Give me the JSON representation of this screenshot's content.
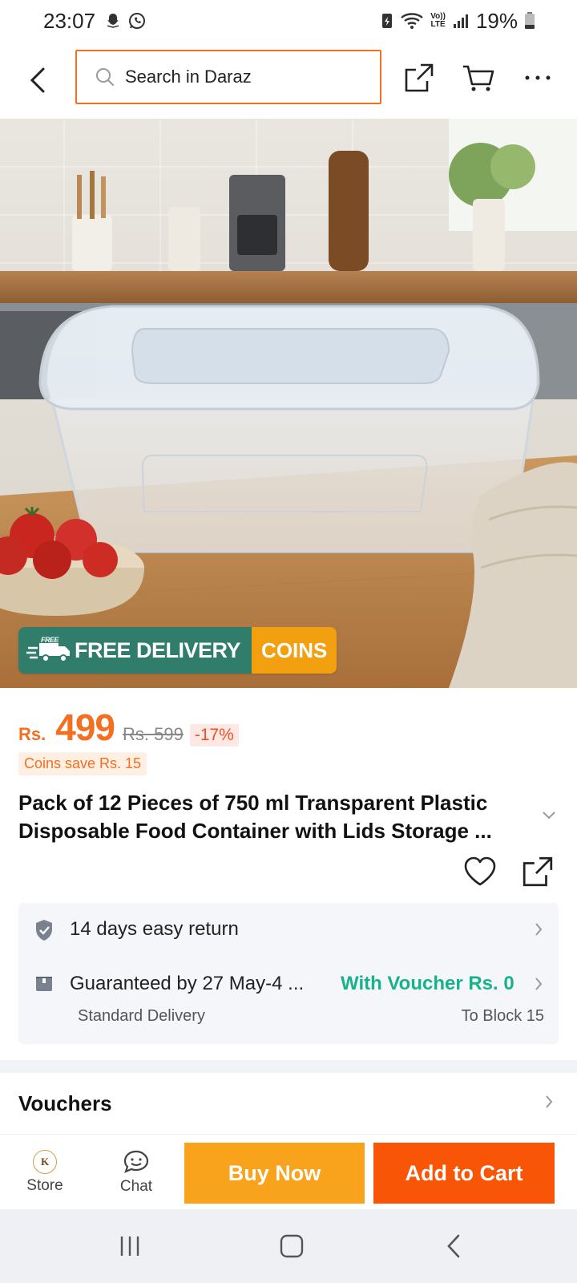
{
  "status_bar": {
    "time": "23:07",
    "battery": "19%",
    "icons": [
      "snapchat-icon",
      "whatsapp-icon",
      "battery-saver-icon",
      "wifi-icon",
      "volte-icon",
      "signal-icon",
      "battery-icon"
    ],
    "lte_label_top": "Vo))",
    "lte_label_bottom": "LTE"
  },
  "header": {
    "search_placeholder": "Search in Daraz",
    "icons": [
      "back-icon",
      "search-icon",
      "share-icon",
      "cart-icon",
      "more-icon"
    ]
  },
  "promo": {
    "free_tag": "FREE",
    "free_delivery": "FREE DELIVERY",
    "coins": "COINS"
  },
  "price": {
    "currency": "Rs.",
    "amount": "499",
    "original": "Rs. 599",
    "discount": "-17%",
    "coins_save": "Coins save Rs. 15"
  },
  "product": {
    "title": "Pack of 12 Pieces of 750 ml Transparent Plastic Disposable Food Container with Lids Storage ..."
  },
  "services": {
    "return_text": "14 days easy return",
    "delivery_text": "Guaranteed by 27 May-4 ...",
    "voucher_text": "With Voucher Rs. 0",
    "delivery_type": "Standard Delivery",
    "delivery_location": "To Block 15"
  },
  "vouchers": {
    "label": "Vouchers"
  },
  "action_bar": {
    "store_label": "Store",
    "store_logo_letter": "K",
    "chat_label": "Chat",
    "buy_now": "Buy Now",
    "add_to_cart": "Add to Cart"
  },
  "colors": {
    "brand_orange": "#f85606",
    "price_orange": "#f36f21",
    "buy_now_yellow": "#f9a21b",
    "voucher_green": "#16b28e",
    "delivery_badge_green": "#2f7d6a",
    "coins_badge": "#f2a00f"
  }
}
